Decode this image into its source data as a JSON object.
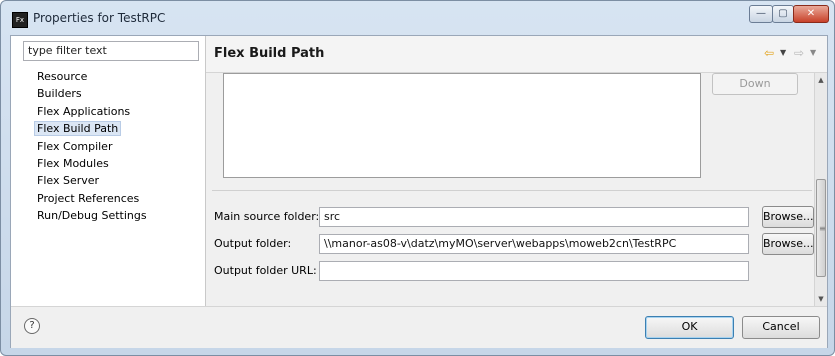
{
  "window": {
    "title": "Properties for TestRPC",
    "icon": "flex-builder-app-icon",
    "controls": {
      "minimize": "—",
      "maximize": "▢",
      "close": "✕"
    }
  },
  "left_panel": {
    "filter_placeholder": "type filter text",
    "items": [
      {
        "label": "Resource"
      },
      {
        "label": "Builders"
      },
      {
        "label": "Flex Applications"
      },
      {
        "label": "Flex Build Path",
        "selected": true
      },
      {
        "label": "Flex Compiler"
      },
      {
        "label": "Flex Modules"
      },
      {
        "label": "Flex Server"
      },
      {
        "label": "Project References"
      },
      {
        "label": "Run/Debug Settings"
      }
    ]
  },
  "header": {
    "title": "Flex Build Path",
    "back_icon": "⇦",
    "forward_icon": "⇨",
    "dropdown_icon": "▼"
  },
  "build_path": {
    "down_button": "Down",
    "main_source_label": "Main source folder:",
    "main_source_value": "src",
    "output_folder_label": "Output folder:",
    "output_folder_value": "\\\\manor-as08-v\\datz\\myMO\\server\\webapps\\moweb2cn\\TestRPC",
    "output_url_label": "Output folder URL:",
    "output_url_value": "",
    "browse_label": "Browse..."
  },
  "footer": {
    "help_icon": "?",
    "ok_label": "OK",
    "cancel_label": "Cancel"
  },
  "colors": {
    "selection": "#dbe6f4",
    "back_arrow": "#e2a21b",
    "default_button_border": "#3c7fb1"
  }
}
